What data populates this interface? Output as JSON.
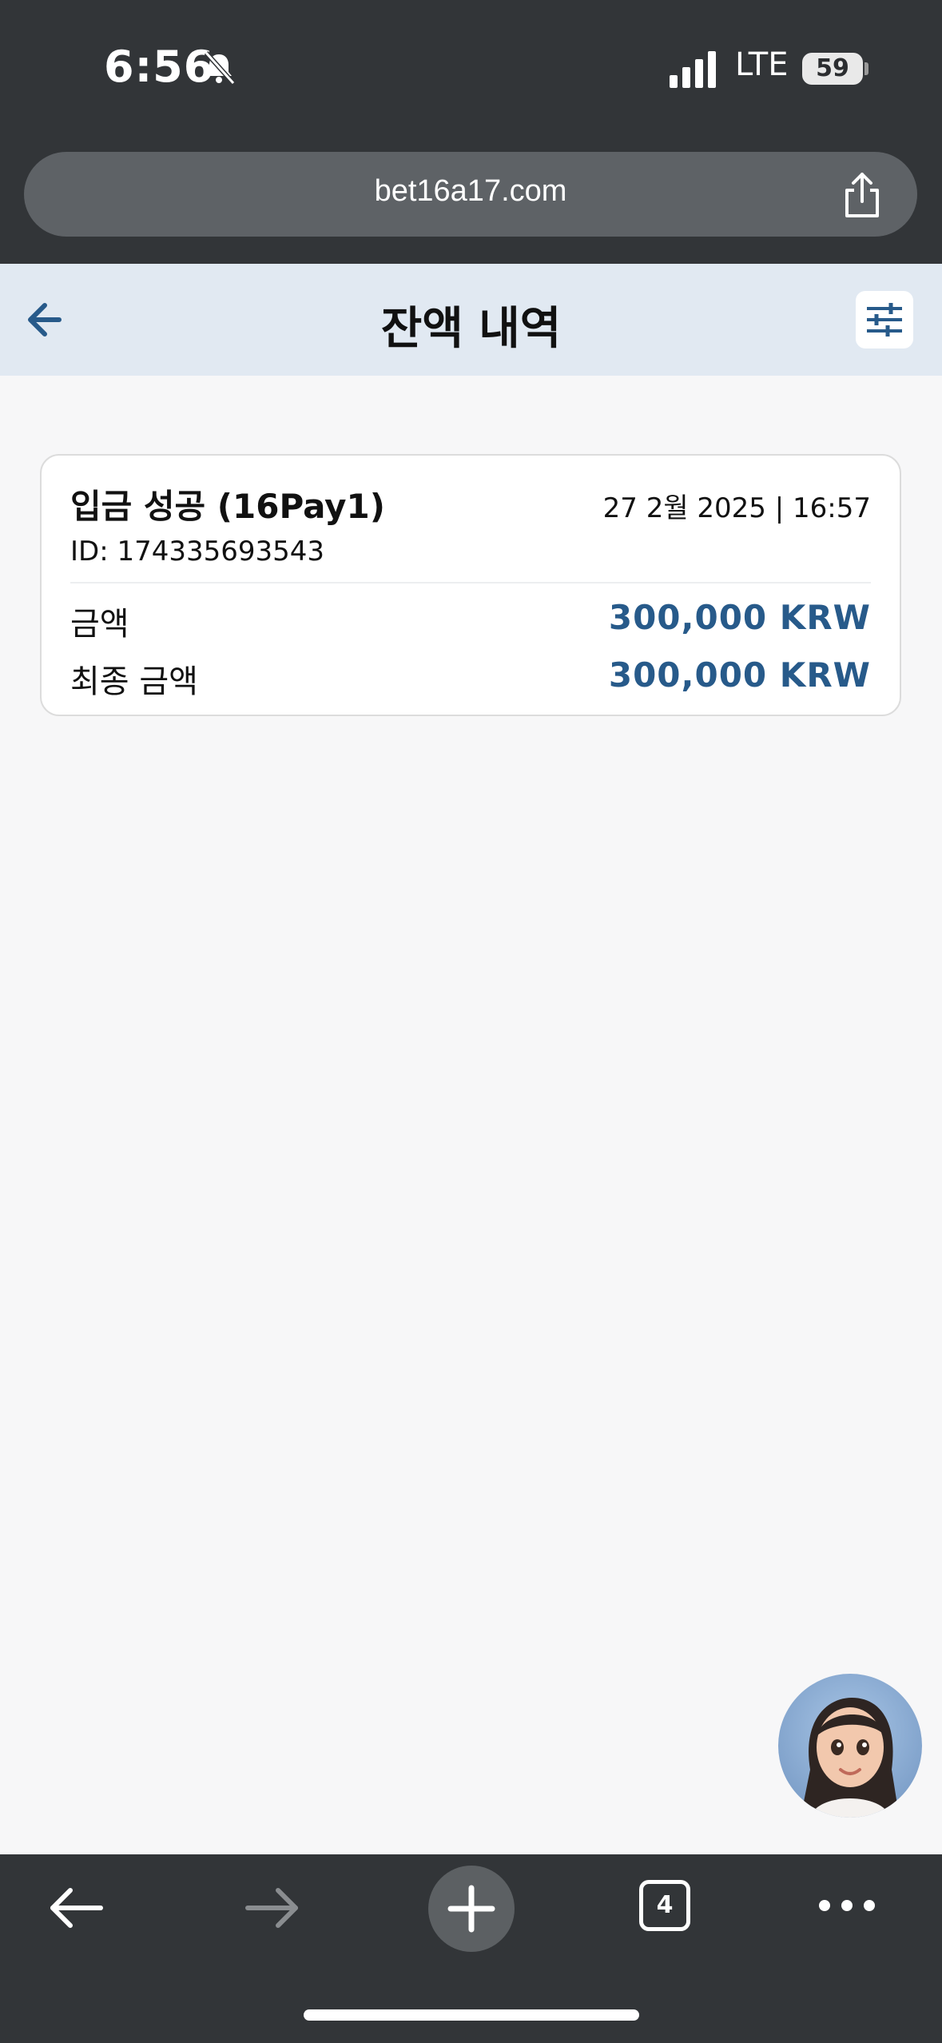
{
  "status_bar": {
    "time": "6:56",
    "network": "LTE",
    "battery": "59"
  },
  "browser": {
    "url": "bet16a17.com",
    "tab_count": "4"
  },
  "header": {
    "title": "잔액 내역"
  },
  "transaction": {
    "title": "입금 성공 (16Pay1)",
    "date": "27 2월 2025 | 16:57",
    "id": "ID: 174335693543",
    "amount_label": "금액",
    "amount_value": "300,000 KRW",
    "final_label": "최종 금액",
    "final_value": "300,000 KRW"
  },
  "colors": {
    "accent": "#275a8a",
    "header_bg": "#e1e9f2",
    "chrome_bg": "#323538"
  },
  "icons": [
    "bell-slash-icon",
    "signal-icon",
    "share-icon",
    "back-arrow-icon",
    "filter-icon",
    "chat-avatar",
    "nav-back-icon",
    "nav-forward-icon",
    "plus-icon",
    "tabs-icon",
    "more-icon"
  ]
}
